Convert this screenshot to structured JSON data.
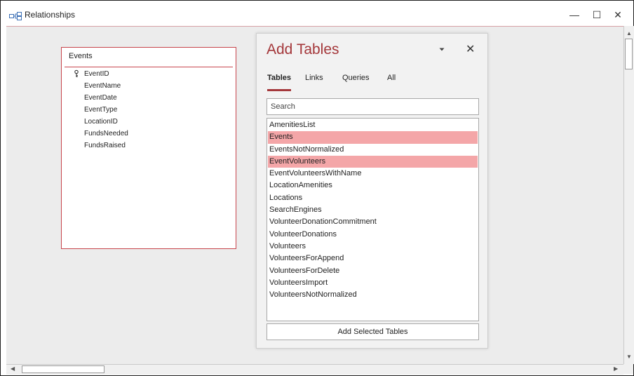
{
  "window": {
    "title": "Relationships",
    "minimize": "—",
    "maximize": "☐",
    "close": "✕",
    "icon": "relationships-icon"
  },
  "events_table": {
    "title": "Events",
    "fields": [
      {
        "name": "EventID",
        "primary_key": true
      },
      {
        "name": "EventName",
        "primary_key": false
      },
      {
        "name": "EventDate",
        "primary_key": false
      },
      {
        "name": "EventType",
        "primary_key": false
      },
      {
        "name": "LocationID",
        "primary_key": false
      },
      {
        "name": "FundsNeeded",
        "primary_key": false
      },
      {
        "name": "FundsRaised",
        "primary_key": false
      }
    ]
  },
  "add_tables": {
    "title": "Add Tables",
    "close": "✕",
    "tabs": [
      "Tables",
      "Links",
      "Queries",
      "All"
    ],
    "active_tab": "Tables",
    "search_placeholder": "Search",
    "items": [
      {
        "label": "AmenitiesList",
        "selected": false
      },
      {
        "label": "Events",
        "selected": true
      },
      {
        "label": "EventsNotNormalized",
        "selected": false
      },
      {
        "label": "EventVolunteers",
        "selected": true
      },
      {
        "label": "EventVolunteersWithName",
        "selected": false
      },
      {
        "label": "LocationAmenities",
        "selected": false
      },
      {
        "label": "Locations",
        "selected": false
      },
      {
        "label": "SearchEngines",
        "selected": false
      },
      {
        "label": "VolunteerDonationCommitment",
        "selected": false
      },
      {
        "label": "VolunteerDonations",
        "selected": false
      },
      {
        "label": "Volunteers",
        "selected": false
      },
      {
        "label": "VolunteersForAppend",
        "selected": false
      },
      {
        "label": "VolunteersForDelete",
        "selected": false
      },
      {
        "label": "VolunteersImport",
        "selected": false
      },
      {
        "label": "VolunteersNotNormalized",
        "selected": false
      }
    ],
    "add_button": "Add Selected Tables"
  },
  "colors": {
    "accent": "#a4373a",
    "selection": "#f4a6a8",
    "table_border": "#c7434b",
    "workspace": "#ececec"
  }
}
